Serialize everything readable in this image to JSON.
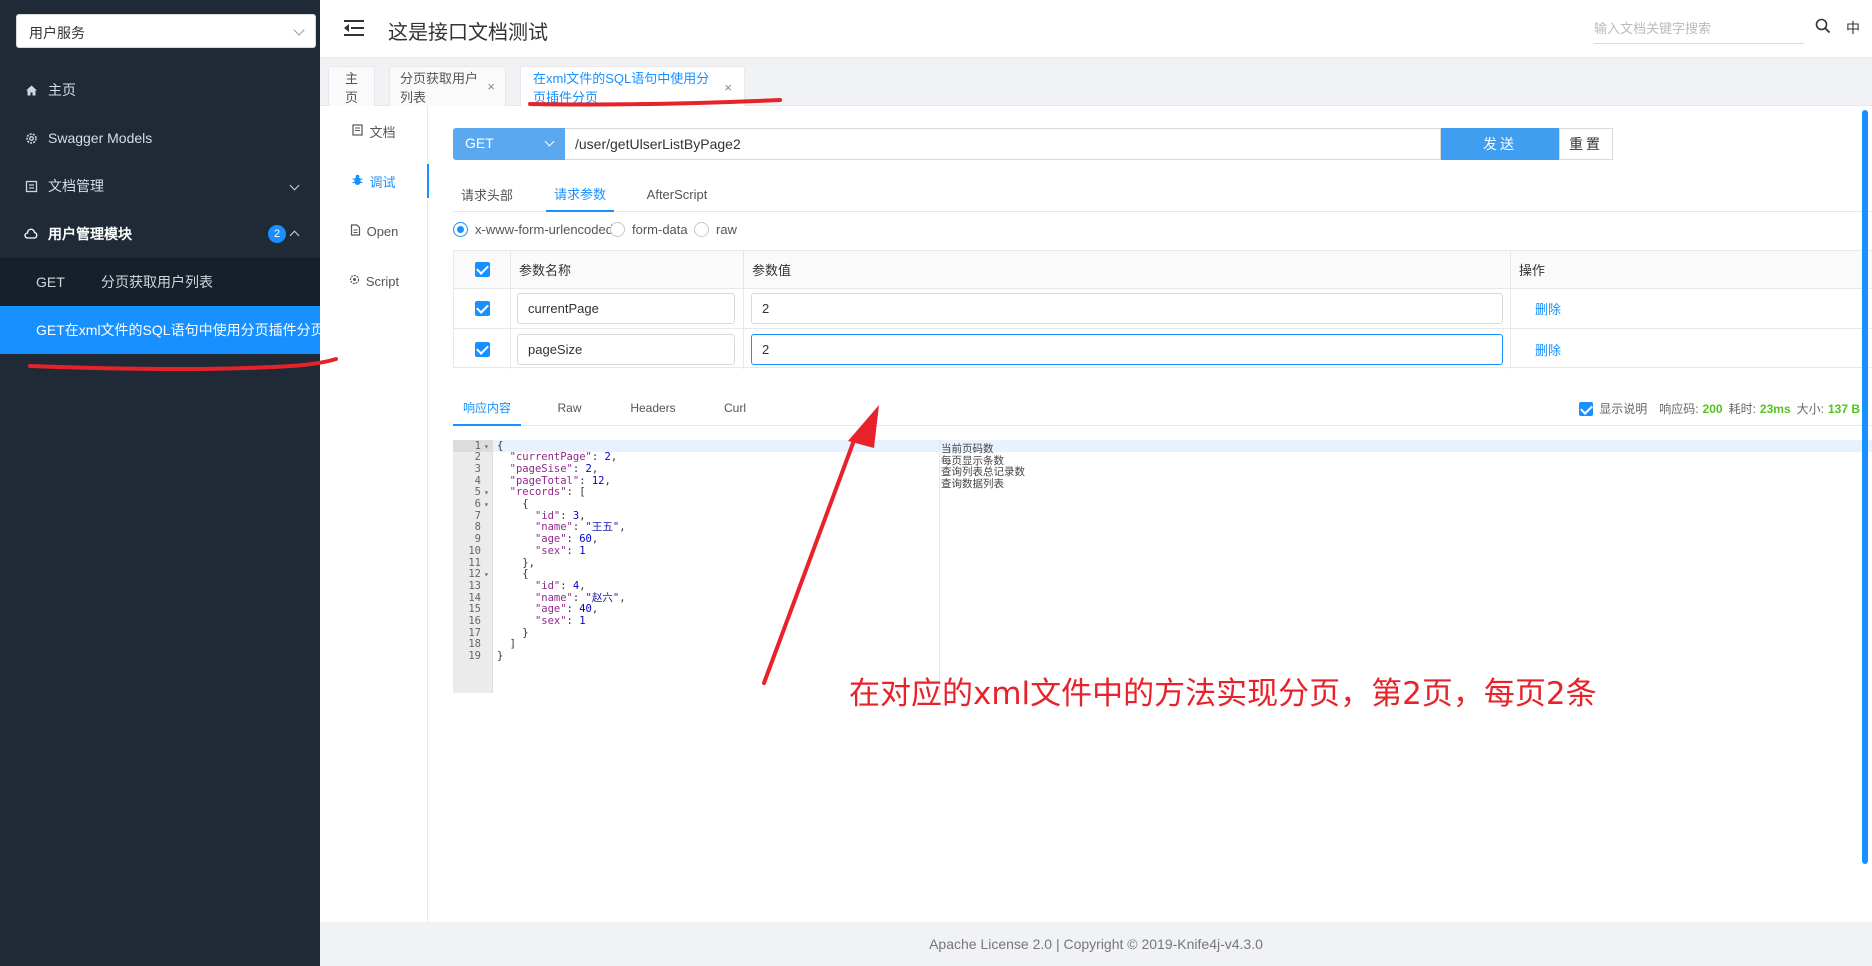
{
  "sidebar": {
    "service_select": "用户服务",
    "items": [
      {
        "label": "主页"
      },
      {
        "label": "Swagger Models"
      },
      {
        "label": "文档管理"
      },
      {
        "label": "用户管理模块",
        "badge": "2"
      }
    ],
    "sub_items": [
      {
        "method": "GET",
        "label": "分页获取用户列表"
      },
      {
        "method": "GET",
        "label": "在xml文件的SQL语句中使用分页插件分页"
      }
    ]
  },
  "header": {
    "title": "这是接口文档测试",
    "search_placeholder": "输入文档关键字搜索",
    "lang": "中"
  },
  "tabs": [
    {
      "label": "主页"
    },
    {
      "label": "分页获取用户列表"
    },
    {
      "label": "在xml文件的SQL语句中使用分页插件分页"
    }
  ],
  "left_tabs": [
    {
      "label": "文档",
      "icon": "doc-icon"
    },
    {
      "label": "调试",
      "icon": "bug-icon"
    },
    {
      "label": "Open",
      "icon": "file-icon"
    },
    {
      "label": "Script",
      "icon": "script-icon"
    }
  ],
  "request": {
    "method": "GET",
    "url": "/user/getUlserListByPage2",
    "send_label": "发送",
    "reset_label": "重置"
  },
  "request_tabs": [
    "请求头部",
    "请求参数",
    "AfterScript"
  ],
  "content_types": [
    "x-www-form-urlencoded",
    "form-data",
    "raw"
  ],
  "params_table": {
    "headers": [
      "参数名称",
      "参数值",
      "操作"
    ],
    "rows": [
      {
        "name": "currentPage",
        "value": "2",
        "action": "删除"
      },
      {
        "name": "pageSize",
        "value": "2",
        "action": "删除"
      }
    ]
  },
  "response_tabs": [
    "响应内容",
    "Raw",
    "Headers",
    "Curl"
  ],
  "response_meta": {
    "show_desc_label": "显示说明",
    "code_label": "响应码:",
    "code": "200",
    "time_label": "耗时:",
    "time": "23ms",
    "size_label": "大小:",
    "size": "137 B"
  },
  "code_lines": [
    {
      "n": "1",
      "fold": true,
      "text": "{"
    },
    {
      "n": "2",
      "text": "  \"currentPage\": 2,"
    },
    {
      "n": "3",
      "text": "  \"pageSise\": 2,"
    },
    {
      "n": "4",
      "text": "  \"pageTotal\": 12,"
    },
    {
      "n": "5",
      "fold": true,
      "text": "  \"records\": ["
    },
    {
      "n": "6",
      "fold": true,
      "text": "    {"
    },
    {
      "n": "7",
      "text": "      \"id\": 3,"
    },
    {
      "n": "8",
      "text": "      \"name\": \"王五\","
    },
    {
      "n": "9",
      "text": "      \"age\": 60,"
    },
    {
      "n": "10",
      "text": "      \"sex\": 1"
    },
    {
      "n": "11",
      "text": "    },"
    },
    {
      "n": "12",
      "fold": true,
      "text": "    {"
    },
    {
      "n": "13",
      "text": "      \"id\": 4,"
    },
    {
      "n": "14",
      "text": "      \"name\": \"赵六\","
    },
    {
      "n": "15",
      "text": "      \"age\": 40,"
    },
    {
      "n": "16",
      "text": "      \"sex\": 1"
    },
    {
      "n": "17",
      "text": "    }"
    },
    {
      "n": "18",
      "text": "  ]"
    },
    {
      "n": "19",
      "text": "}"
    }
  ],
  "descriptions": [
    "当前页码数",
    "每页显示条数",
    "查询列表总记录数",
    "查询数据列表"
  ],
  "annotation": "在对应的xml文件中的方法实现分页，第2页，每页2条",
  "footer": "Apache License 2.0 | Copyright © 2019-Knife4j-v4.3.0",
  "colors": {
    "accent": "#1890ff",
    "sidebar_bg": "#1f2a36",
    "annotation": "#e8222a",
    "success": "#52c41a"
  }
}
